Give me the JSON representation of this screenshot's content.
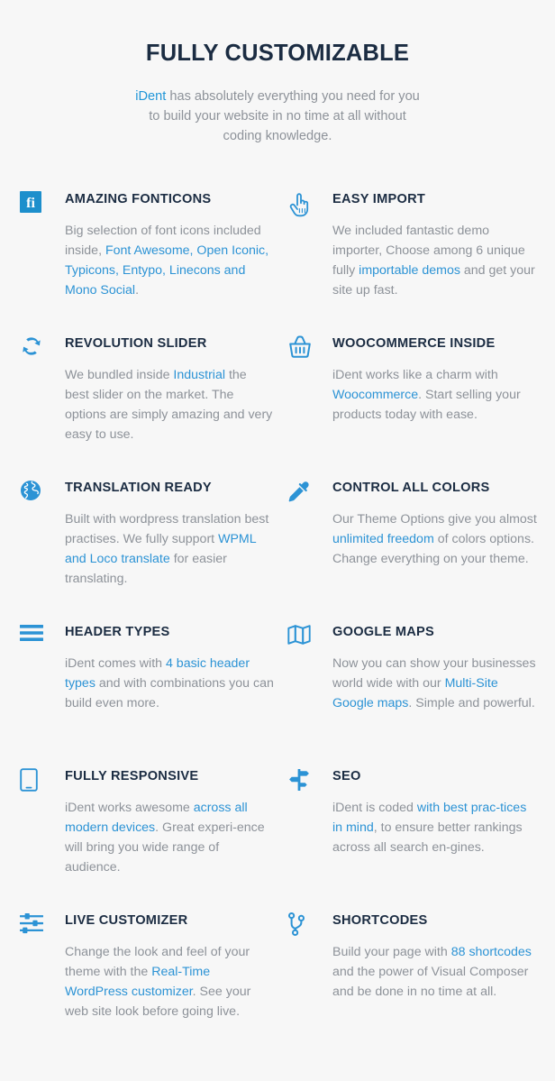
{
  "header": {
    "title": "FULLY CUSTOMIZABLE",
    "brand": "iDent",
    "subtitle_rest": " has absolutely everything you need for you to build your website in no time at all without coding knowledge."
  },
  "colors": {
    "accent": "#2c93d5",
    "heading": "#1b2c42",
    "body_text": "#8d9299",
    "background": "#f7f7f7",
    "fonticons_badge": "#1d8fcc"
  },
  "features": [
    {
      "icon": "fonticons-icon",
      "title": "AMAZING FONTICONS",
      "segments": [
        {
          "text": "Big selection of font icons included inside, ",
          "link": false
        },
        {
          "text": "Font Awesome, Open Iconic, Typicons, Entypo, Linecons and Mono Social",
          "link": true
        },
        {
          "text": ".",
          "link": false
        }
      ]
    },
    {
      "icon": "pointing-hand-icon",
      "title": "EASY IMPORT",
      "segments": [
        {
          "text": "We included fantastic demo importer, Choose among 6 unique fully ",
          "link": false
        },
        {
          "text": "importable demos",
          "link": true
        },
        {
          "text": " and get your site up fast.",
          "link": false
        }
      ]
    },
    {
      "icon": "refresh-sync-icon",
      "title": "REVOLUTION SLIDER",
      "segments": [
        {
          "text": "We bundled inside ",
          "link": false
        },
        {
          "text": "Industrial",
          "link": true
        },
        {
          "text": " the best slider on the market. The options are simply amazing and very easy to use.",
          "link": false
        }
      ]
    },
    {
      "icon": "shopping-basket-icon",
      "title": "WOOCOMMERCE INSIDE",
      "segments": [
        {
          "text": "iDent works like a charm with ",
          "link": false
        },
        {
          "text": "Woocommerce",
          "link": true
        },
        {
          "text": ". Start selling your products  today with ease.",
          "link": false
        }
      ]
    },
    {
      "icon": "globe-icon",
      "title": "TRANSLATION READY",
      "segments": [
        {
          "text": "Built with wordpress translation best practises. We fully support ",
          "link": false
        },
        {
          "text": "WPML and Loco translate",
          "link": true
        },
        {
          "text": " for easier translating.",
          "link": false
        }
      ]
    },
    {
      "icon": "eyedropper-icon",
      "title": "CONTROL ALL COLORS",
      "segments": [
        {
          "text": "Our Theme Options give you almost ",
          "link": false
        },
        {
          "text": "unlimited freedom",
          "link": true
        },
        {
          "text": " of colors options. Change everything on your theme.",
          "link": false
        }
      ]
    },
    {
      "icon": "hamburger-menu-icon",
      "title": "HEADER TYPES",
      "segments": [
        {
          "text": "iDent comes with ",
          "link": false
        },
        {
          "text": "4 basic header types",
          "link": true
        },
        {
          "text": " and with combinations you can build even more.",
          "link": false
        }
      ]
    },
    {
      "icon": "folded-map-icon",
      "title": "GOOGLE MAPS",
      "segments": [
        {
          "text": "Now you can show your businesses world wide with our ",
          "link": false
        },
        {
          "text": "Multi-Site Google maps",
          "link": true
        },
        {
          "text": ". Simple and powerful.",
          "link": false
        }
      ]
    },
    {
      "icon": "tablet-device-icon",
      "title": "FULLY RESPONSIVE",
      "segments": [
        {
          "text": "iDent works awesome ",
          "link": false
        },
        {
          "text": "across all modern devices",
          "link": true
        },
        {
          "text": ". Great experi-ence will bring you wide range of audience.",
          "link": false
        }
      ]
    },
    {
      "icon": "signpost-icon",
      "title": "SEO",
      "segments": [
        {
          "text": "iDent is coded ",
          "link": false
        },
        {
          "text": "with best prac-tices in mind",
          "link": true
        },
        {
          "text": ", to ensure better rankings across all search en-gines.",
          "link": false
        }
      ]
    },
    {
      "icon": "sliders-equalizer-icon",
      "title": "LIVE CUSTOMIZER",
      "segments": [
        {
          "text": "Change the look and feel of your theme with the ",
          "link": false
        },
        {
          "text": "Real-Time WordPress customizer",
          "link": true
        },
        {
          "text": ". See your web site look before going live.",
          "link": false
        }
      ]
    },
    {
      "icon": "git-branch-icon",
      "title": "SHORTCODES",
      "segments": [
        {
          "text": "Build your page with ",
          "link": false
        },
        {
          "text": "88 shortcodes",
          "link": true
        },
        {
          "text": " and the power of Visual Composer and be done in no time at all.",
          "link": false
        }
      ]
    }
  ]
}
